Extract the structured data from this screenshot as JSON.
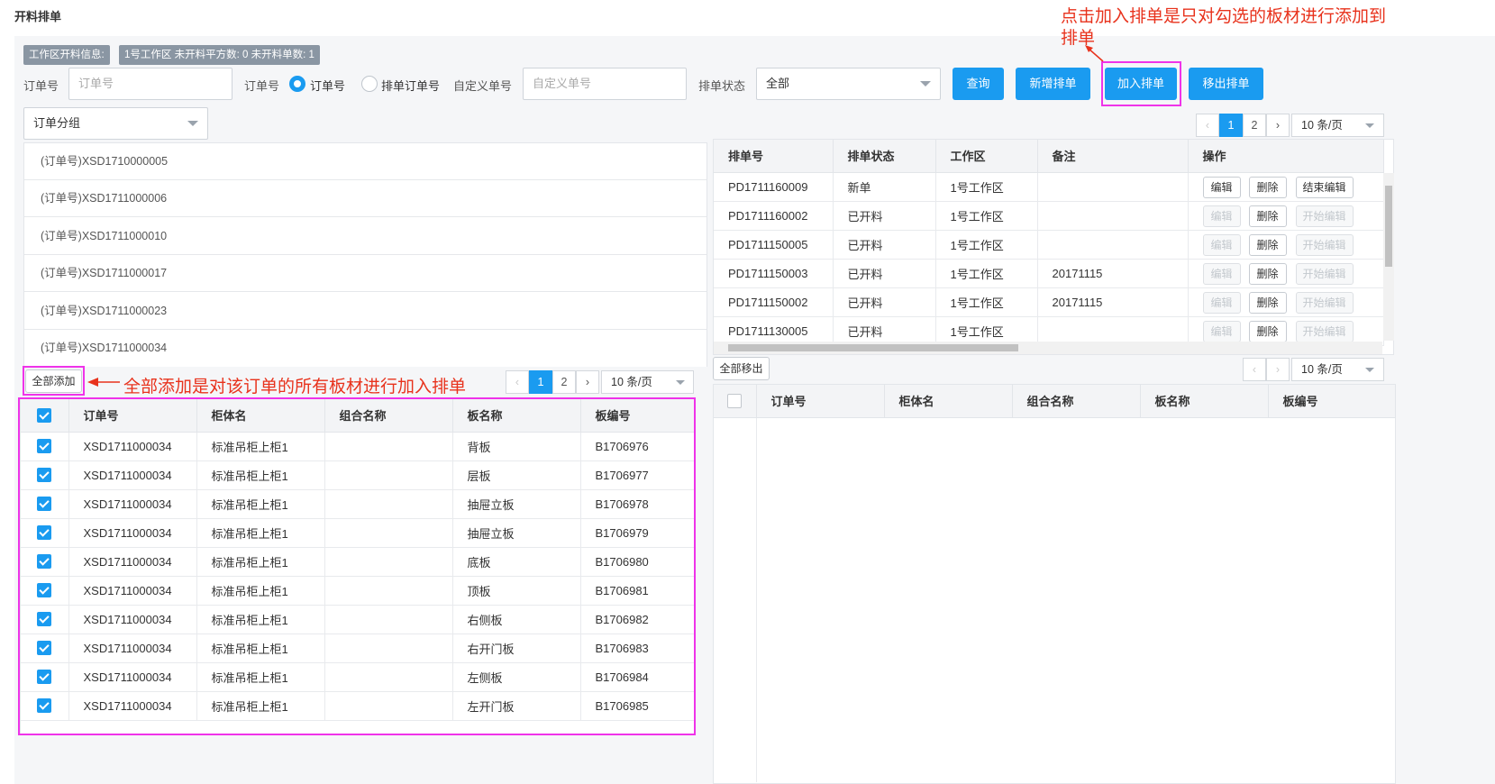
{
  "page": {
    "title": "开料排单"
  },
  "info": {
    "label": "工作区开料信息:",
    "summary": "1号工作区 未开料平方数: 0 未开料单数: 1"
  },
  "filters": {
    "order_no_label": "订单号",
    "order_no_placeholder": "订单号",
    "type_label": "订单号",
    "radio_order": "订单号",
    "radio_schedule": "排单订单号",
    "custom_label": "自定义单号",
    "custom_placeholder": "自定义单号",
    "status_label": "排单状态",
    "status_value": "全部",
    "group_value": "订单分组"
  },
  "toolbar": {
    "query": "查询",
    "new_schedule": "新增排单",
    "add_schedule": "加入排单",
    "remove_schedule": "移出排单"
  },
  "orders": [
    "(订单号)XSD1710000005",
    "(订单号)XSD1711000006",
    "(订单号)XSD1711000010",
    "(订单号)XSD1711000017",
    "(订单号)XSD1711000023",
    "(订单号)XSD1711000034"
  ],
  "left_actions": {
    "add_all": "全部添加"
  },
  "pager_left": {
    "prev": "‹",
    "p1": "1",
    "p2": "2",
    "next": "›",
    "size": "10 条/页"
  },
  "pager_right_top": {
    "prev": "‹",
    "p1": "1",
    "p2": "2",
    "next": "›",
    "size": "10 条/页"
  },
  "pager_right_bottom": {
    "prev": "‹",
    "next": "›",
    "size": "10 条/页"
  },
  "boards_table": {
    "headers": [
      "订单号",
      "柜体名",
      "组合名称",
      "板名称",
      "板编号"
    ],
    "rows": [
      [
        "XSD1711000034",
        "标准吊柜上柜1",
        "",
        "背板",
        "B1706976"
      ],
      [
        "XSD1711000034",
        "标准吊柜上柜1",
        "",
        "层板",
        "B1706977"
      ],
      [
        "XSD1711000034",
        "标准吊柜上柜1",
        "",
        "抽屉立板",
        "B1706978"
      ],
      [
        "XSD1711000034",
        "标准吊柜上柜1",
        "",
        "抽屉立板",
        "B1706979"
      ],
      [
        "XSD1711000034",
        "标准吊柜上柜1",
        "",
        "底板",
        "B1706980"
      ],
      [
        "XSD1711000034",
        "标准吊柜上柜1",
        "",
        "顶板",
        "B1706981"
      ],
      [
        "XSD1711000034",
        "标准吊柜上柜1",
        "",
        "右侧板",
        "B1706982"
      ],
      [
        "XSD1711000034",
        "标准吊柜上柜1",
        "",
        "右开门板",
        "B1706983"
      ],
      [
        "XSD1711000034",
        "标准吊柜上柜1",
        "",
        "左侧板",
        "B1706984"
      ],
      [
        "XSD1711000034",
        "标准吊柜上柜1",
        "",
        "左开门板",
        "B1706985"
      ]
    ]
  },
  "schedule_table": {
    "headers": [
      "排单号",
      "排单状态",
      "工作区",
      "备注",
      "操作"
    ],
    "rows": [
      {
        "no": "PD1711160009",
        "status": "新单",
        "area": "1号工作区",
        "note": "",
        "edit": "编辑",
        "del": "删除",
        "toggle": "结束编辑",
        "enabled": true
      },
      {
        "no": "PD1711160002",
        "status": "已开料",
        "area": "1号工作区",
        "note": "",
        "edit": "编辑",
        "del": "删除",
        "toggle": "开始编辑",
        "enabled": false
      },
      {
        "no": "PD1711150005",
        "status": "已开料",
        "area": "1号工作区",
        "note": "",
        "edit": "编辑",
        "del": "删除",
        "toggle": "开始编辑",
        "enabled": false
      },
      {
        "no": "PD1711150003",
        "status": "已开料",
        "area": "1号工作区",
        "note": "20171115",
        "edit": "编辑",
        "del": "删除",
        "toggle": "开始编辑",
        "enabled": false
      },
      {
        "no": "PD1711150002",
        "status": "已开料",
        "area": "1号工作区",
        "note": "20171115",
        "edit": "编辑",
        "del": "删除",
        "toggle": "开始编辑",
        "enabled": false
      },
      {
        "no": "PD1711130005",
        "status": "已开料",
        "area": "1号工作区",
        "note": "",
        "edit": "编辑",
        "del": "删除",
        "toggle": "开始编辑",
        "enabled": false
      }
    ]
  },
  "right_actions": {
    "remove_all": "全部移出"
  },
  "scheduled_boards_table": {
    "headers": [
      "订单号",
      "柜体名",
      "组合名称",
      "板名称",
      "板编号"
    ]
  },
  "annotations": {
    "top_right": "点击加入排单是只对勾选的板材进行添加到",
    "top_right_line2": "排单",
    "left": "全部添加是对该订单的所有板材进行加入排单"
  },
  "colors": {
    "primary": "#1a9bf0",
    "highlight": "#ef33e9",
    "annotation": "#e8321c"
  }
}
